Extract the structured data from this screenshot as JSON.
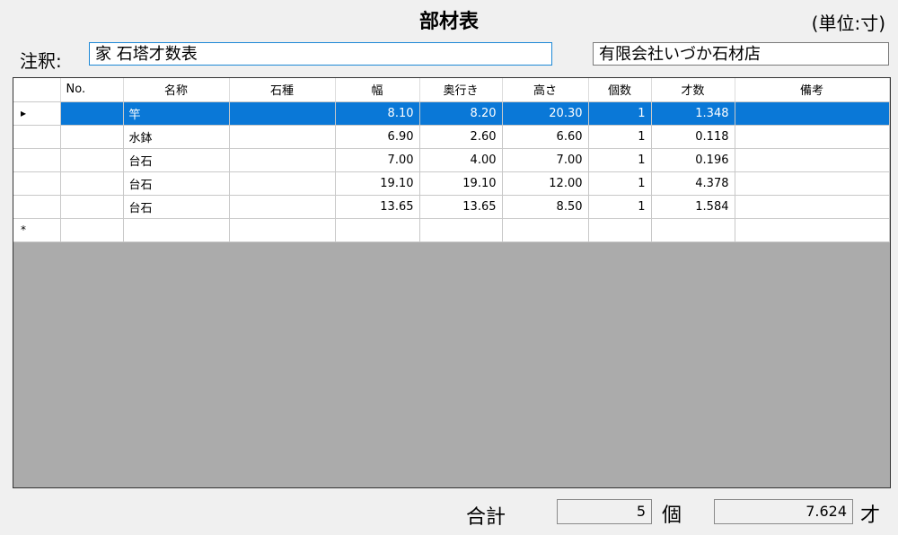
{
  "header": {
    "title": "部材表",
    "unit": "(単位:寸)"
  },
  "note": {
    "label": "注釈:",
    "value": "家 石塔才数表"
  },
  "company": {
    "value": "有限会社いづか石材店"
  },
  "grid": {
    "columns": [
      "",
      "No.",
      "名称",
      "石種",
      "幅",
      "奥行き",
      "高さ",
      "個数",
      "才数",
      "備考"
    ],
    "rows": [
      {
        "marker": "▸",
        "no": "",
        "name": "竿",
        "stone": "",
        "width": "8.10",
        "depth": "8.20",
        "height": "20.30",
        "count": "1",
        "sai": "1.348",
        "remarks": ""
      },
      {
        "marker": "",
        "no": "",
        "name": "水鉢",
        "stone": "",
        "width": "6.90",
        "depth": "2.60",
        "height": "6.60",
        "count": "1",
        "sai": "0.118",
        "remarks": ""
      },
      {
        "marker": "",
        "no": "",
        "name": "台石",
        "stone": "",
        "width": "7.00",
        "depth": "4.00",
        "height": "7.00",
        "count": "1",
        "sai": "0.196",
        "remarks": ""
      },
      {
        "marker": "",
        "no": "",
        "name": "台石",
        "stone": "",
        "width": "19.10",
        "depth": "19.10",
        "height": "12.00",
        "count": "1",
        "sai": "4.378",
        "remarks": ""
      },
      {
        "marker": "",
        "no": "",
        "name": "台石",
        "stone": "",
        "width": "13.65",
        "depth": "13.65",
        "height": "8.50",
        "count": "1",
        "sai": "1.584",
        "remarks": ""
      }
    ],
    "new_row_marker": "*"
  },
  "totals": {
    "label": "合計",
    "count": "5",
    "count_unit": "個",
    "sai": "7.624",
    "sai_unit": "才"
  },
  "colors": {
    "selection": "#0a78d7",
    "grid_empty": "#ababab"
  }
}
